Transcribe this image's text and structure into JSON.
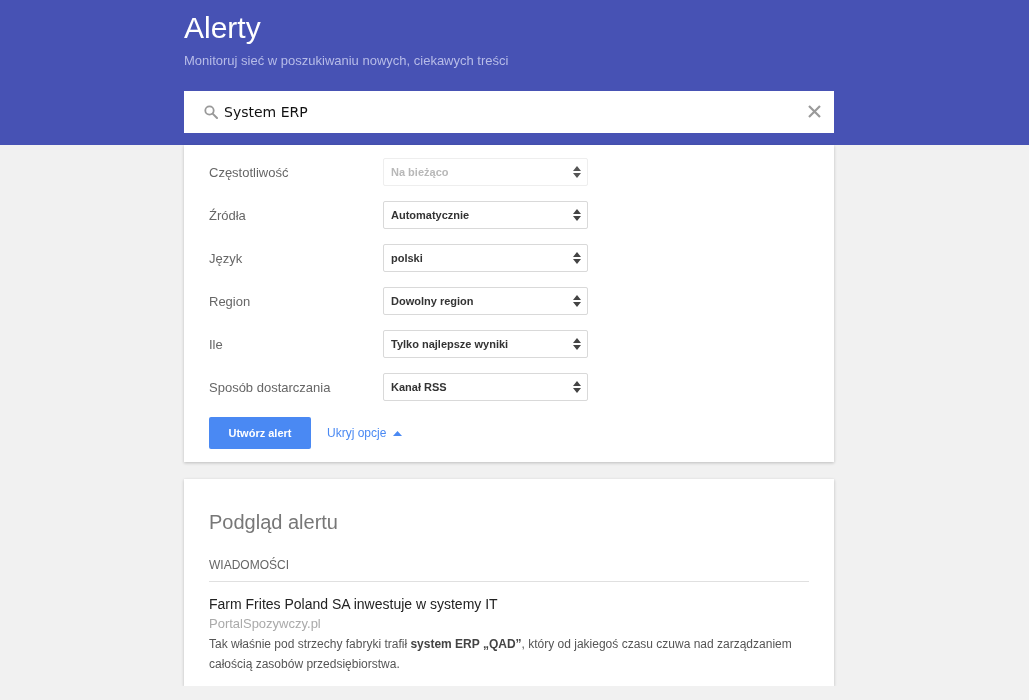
{
  "header": {
    "title": "Alerty",
    "subtitle": "Monitoruj sieć w poszukiwaniu nowych, ciekawych treści"
  },
  "search": {
    "value": "System ERP"
  },
  "options": [
    {
      "label": "Częstotliwość",
      "value": "Na bieżąco",
      "disabled": true
    },
    {
      "label": "Źródła",
      "value": "Automatycznie",
      "disabled": false
    },
    {
      "label": "Język",
      "value": "polski",
      "disabled": false
    },
    {
      "label": "Region",
      "value": "Dowolny region",
      "disabled": false
    },
    {
      "label": "Ile",
      "value": "Tylko najlepsze wyniki",
      "disabled": false
    },
    {
      "label": "Sposób dostarczania",
      "value": "Kanał RSS",
      "disabled": false
    }
  ],
  "create_button": "Utwórz alert",
  "options_toggle": {
    "label": "Ukryj opcje",
    "expanded": true
  },
  "preview": {
    "title": "Podgląd alertu",
    "section": "WIADOMOŚCI",
    "articles": [
      {
        "title": "Farm Frites Poland SA inwestuje w systemy IT",
        "source": "PortalSpozywczy.pl",
        "snippet": "Tak właśnie pod strzechy fabryki trafił **system ERP „QAD”**, który od jakiegoś czasu czuwa nad zarządzaniem całością zasobów przedsiębiorstwa."
      }
    ]
  }
}
